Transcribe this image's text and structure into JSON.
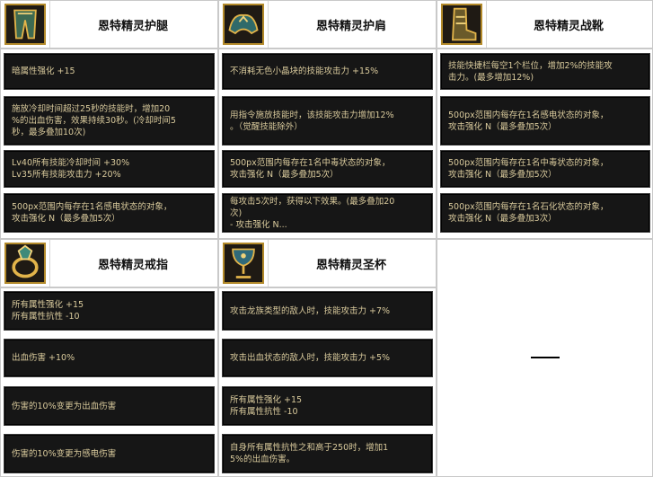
{
  "items": [
    {
      "title": "恩特精灵护腿",
      "icon": "leggings-icon",
      "effects": [
        "暗属性强化 +15",
        "施放冷却时间超过25秒的技能时，增加20\n%的出血伤害，效果持续30秒。(冷却时间5\n秒，最多叠加10次)",
        "Lv40所有技能冷却时间 +30%\nLv35所有技能攻击力 +20%",
        "500px范围内每存在1名感电状态的对象，\n攻击强化 N（最多叠加5次）"
      ]
    },
    {
      "title": "恩特精灵护肩",
      "icon": "shoulder-armor-icon",
      "effects": [
        "不消耗无色小晶块的技能攻击力 +15%",
        "用指令施放技能时，该技能攻击力增加12%\n。（觉醒技能除外）",
        "500px范围内每存在1名中毒状态的对象，\n攻击强化 N（最多叠加5次）",
        "每攻击5次时，获得以下效果。(最多叠加20\n次)\n- 攻击强化 N..."
      ]
    },
    {
      "title": "恩特精灵战靴",
      "icon": "boots-icon",
      "effects": [
        "技能快捷栏每空1个栏位，增加2%的技能攻\n击力。(最多增加12%)",
        "500px范围内每存在1名感电状态的对象，\n攻击强化 N（最多叠加5次）",
        "500px范围内每存在1名中毒状态的对象，\n攻击强化 N（最多叠加5次）",
        "500px范围内每存在1名石化状态的对象，\n攻击强化 N（最多叠加3次）"
      ]
    },
    {
      "title": "恩特精灵戒指",
      "icon": "ring-icon",
      "effects": [
        "所有属性强化 +15\n所有属性抗性 -10",
        "出血伤害 +10%",
        "伤害的10%变更为出血伤害",
        "伤害的10%变更为感电伤害"
      ]
    },
    {
      "title": "恩特精灵圣杯",
      "icon": "chalice-icon",
      "effects": [
        "攻击龙族类型的敌人时，技能攻击力 +7%",
        "攻击出血状态的敌人时，技能攻击力 +5%",
        "所有属性强化 +15\n所有属性抗性 -10",
        "自身所有属性抗性之和高于250时，增加1\n5%的出血伤害。"
      ]
    }
  ],
  "empty_cell": "—",
  "colors": {
    "box_bg": "#161616",
    "box_text": "#d9ca9c",
    "icon_border": "#b38a2a"
  }
}
